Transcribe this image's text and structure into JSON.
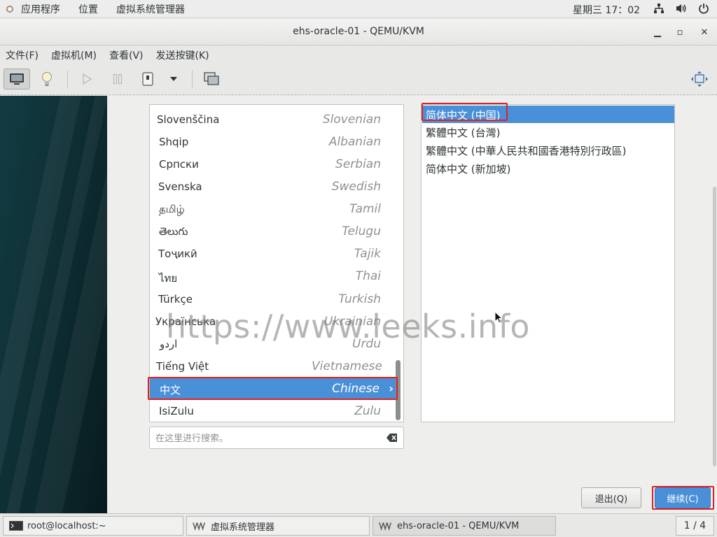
{
  "topbar": {
    "applications": "应用程序",
    "places": "位置",
    "app_name": "虚拟系统管理器",
    "clock": "星期三 17：02"
  },
  "window": {
    "title": "ehs-oracle-01 - QEMU/KVM",
    "minimize": "▁",
    "maximize": "▫",
    "close": "✕"
  },
  "menubar": {
    "items": [
      "文件(F)",
      "虚拟机(M)",
      "查看(V)",
      "发送按键(K)"
    ]
  },
  "installer": {
    "languages": [
      {
        "native": "Slovenščina",
        "english": "Slovenian"
      },
      {
        "native": "Shqip",
        "english": "Albanian"
      },
      {
        "native": "Српски",
        "english": "Serbian"
      },
      {
        "native": "Svenska",
        "english": "Swedish"
      },
      {
        "native": "தமிழ்",
        "english": "Tamil"
      },
      {
        "native": "తెలుగు",
        "english": "Telugu"
      },
      {
        "native": "Тоҷикӣ",
        "english": "Tajik"
      },
      {
        "native": "ไทย",
        "english": "Thai"
      },
      {
        "native": "Türkçe",
        "english": "Turkish"
      },
      {
        "native": "Українська",
        "english": "Ukrainian"
      },
      {
        "native": "اردو",
        "english": "Urdu"
      },
      {
        "native": "Tiếng Việt",
        "english": "Vietnamese"
      },
      {
        "native": "中文",
        "english": "Chinese",
        "selected": true
      },
      {
        "native": "IsiZulu",
        "english": "Zulu"
      }
    ],
    "search_placeholder": "在这里进行搜索。",
    "locales": [
      {
        "label": "简体中文 (中国)",
        "selected": true
      },
      {
        "label": "繁體中文 (台灣)"
      },
      {
        "label": "繁體中文 (中華人民共和國香港特別行政區)"
      },
      {
        "label": "简体中文 (新加坡)"
      }
    ],
    "quit_label": "退出(Q)",
    "continue_label": "继续(C)"
  },
  "watermark": "https://www.leeks.info",
  "taskbar": {
    "tasks": [
      "root@localhost:~",
      "虚拟系统管理器",
      "ehs-oracle-01 - QEMU/KVM"
    ],
    "pager": "1 / 4"
  },
  "colors": {
    "selection": "#4a90d9",
    "highlight_box": "#e02020",
    "sidebar": "#0f3237"
  },
  "icons": {
    "toolbar": [
      "monitor-icon",
      "lightbulb-icon",
      "play-icon",
      "pause-icon",
      "power-icon",
      "dropdown-icon",
      "screenshot-icon",
      "fullscreen-icon"
    ],
    "tray": [
      "network-icon",
      "volume-icon",
      "power-icon"
    ]
  }
}
